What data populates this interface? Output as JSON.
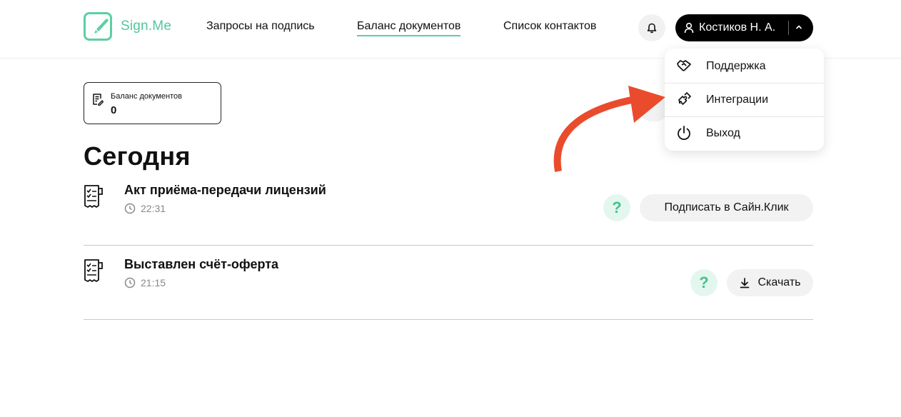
{
  "app": {
    "logo_text": "Sign.Me",
    "brand_color": "#5ccfa3"
  },
  "nav": {
    "items": [
      {
        "label": "Запросы на подпись",
        "active": false
      },
      {
        "label": "Баланс документов",
        "active": true
      },
      {
        "label": "Список контактов",
        "active": false
      }
    ]
  },
  "header": {
    "bell_icon": "bell-icon",
    "user_name": "Костиков Н. А."
  },
  "user_menu": {
    "items": [
      {
        "label": "Поддержка",
        "icon": "handshake-icon"
      },
      {
        "label": "Интеграции",
        "icon": "puzzle-icon"
      },
      {
        "label": "Выход",
        "icon": "power-icon"
      }
    ]
  },
  "balance": {
    "label": "Баланс документов",
    "value": "0"
  },
  "section": {
    "title": "Сегодня"
  },
  "documents": [
    {
      "title": "Акт приёма-передачи лицензий",
      "time": "22:31",
      "action": "Подписать в Сайн.Клик",
      "help": "?"
    },
    {
      "title": "Выставлен счёт-оферта",
      "time": "21:15",
      "action": "Скачать",
      "help": "?"
    }
  ],
  "colors": {
    "accent": "#5ccfa3",
    "help_bg": "#e4f7ef",
    "arrow": "#ea4b2c"
  }
}
